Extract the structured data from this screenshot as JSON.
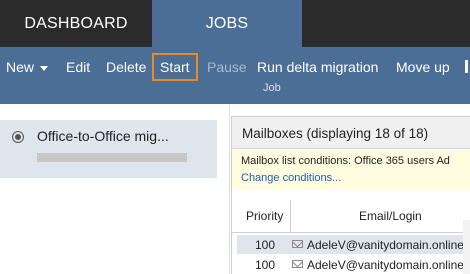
{
  "top_tabs": {
    "dashboard": "DASHBOARD",
    "jobs": "JOBS"
  },
  "ribbon": {
    "new": "New",
    "edit": "Edit",
    "delete": "Delete",
    "start": "Start",
    "pause": "Pause",
    "run_delta": "Run delta migration",
    "move_up": "Move up",
    "group_label": "Job"
  },
  "jobs_list": {
    "items": [
      {
        "name": "Office-to-Office mig...",
        "progress": 0
      }
    ]
  },
  "mailboxes": {
    "title": "Mailboxes (displaying 18 of 18)",
    "conditions_text": "Mailbox list conditions: Office 365 users Ad",
    "change_link": "Change conditions...",
    "columns": {
      "priority": "Priority",
      "email": "Email/Login"
    },
    "rows": [
      {
        "priority": "100",
        "email": "AdeleV@vanitydomain.online"
      },
      {
        "priority": "100",
        "email": "AdeleV@vanitydomain.online"
      }
    ]
  },
  "colors": {
    "accent": "#4a6e96",
    "topbar": "#2b2b2b",
    "highlight_border": "#e88a2c",
    "selection": "#dfe5ec",
    "link": "#1f5fa8"
  }
}
